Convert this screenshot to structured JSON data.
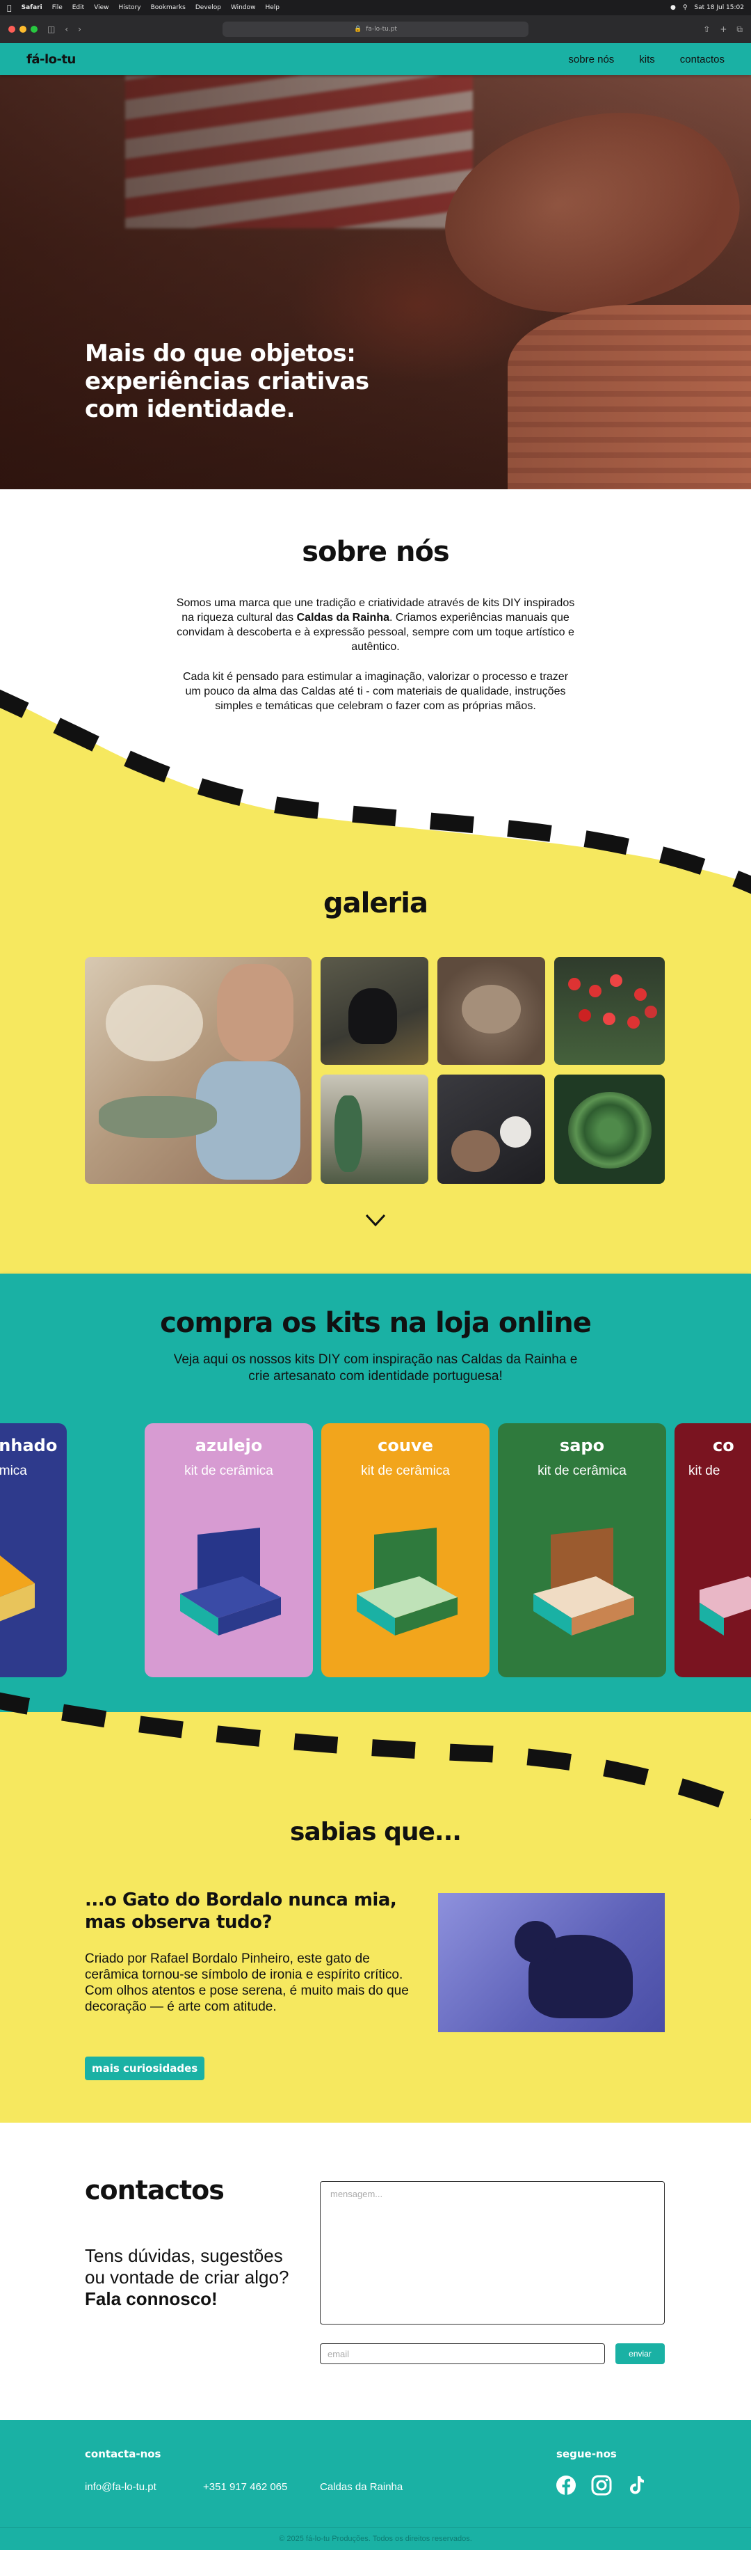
{
  "menubar": {
    "items": [
      "Safari",
      "File",
      "Edit",
      "View",
      "History",
      "Bookmarks",
      "Develop",
      "Window",
      "Help"
    ],
    "clock": "Sat 18 Jul 15:02"
  },
  "browser": {
    "url": "fa-lo-tu.pt"
  },
  "nav": {
    "logo": "fá-lo-tu",
    "links": [
      "sobre nós",
      "kits",
      "contactos"
    ]
  },
  "hero": {
    "headline": "Mais do que objetos: experiências criativas com identidade."
  },
  "sobre": {
    "title": "sobre nós",
    "p1_a": "Somos uma marca que une tradição e criatividade através de kits DIY inspirados na riqueza cultural das ",
    "p1_bold": "Caldas da Rainha",
    "p1_b": ". Criamos experiências manuais que convidam à descoberta e à expressão pessoal, sempre com um toque artístico e autêntico.",
    "p2": "Cada kit é pensado para estimular a imaginação, valorizar o processo e trazer um pouco da alma das Caldas até ti - com materiais de qualidade, instruções simples e temáticas que celebram o fazer com as próprias mãos."
  },
  "galeria": {
    "title": "galeria"
  },
  "shop": {
    "title": "compra os kits na loja online",
    "subtitle": "Veja aqui os nossos kits DIY com inspiração nas Caldas da Rainha e crie artesanato com identidade portuguesa!",
    "kits": [
      {
        "name": "gato assanhado",
        "sub": "kit de cerâmica",
        "color": "#2e3a8c"
      },
      {
        "name": "azulejo",
        "sub": "kit de cerâmica",
        "color": "#d79bd2"
      },
      {
        "name": "couve",
        "sub": "kit de cerâmica",
        "color": "#f2a51c"
      },
      {
        "name": "sapo",
        "sub": "kit de cerâmica",
        "color": "#2f7a3d"
      },
      {
        "name": "co",
        "sub": "kit de",
        "color": "#7a1420"
      }
    ]
  },
  "sabias": {
    "title": "sabias que...",
    "heading": "...o Gato do Bordalo nunca mia, mas observa tudo?",
    "text1": "Criado por Rafael Bordalo Pinheiro, este gato de cerâmica tornou-se símbolo de ironia e espírito crítico.",
    "text2": "Com olhos atentos e pose serena, é muito mais do que decoração — é arte com atitude.",
    "button": "mais curiosidades"
  },
  "contactos": {
    "title": "contactos",
    "question": "Tens dúvidas, sugestões ou vontade de criar algo?",
    "cta": "Fala connosco!",
    "message_placeholder": "mensagem...",
    "email_placeholder": "email",
    "send": "enviar"
  },
  "footer": {
    "contact_heading": "contacta-nos",
    "email": "info@fa-lo-tu.pt",
    "phone": "+351 917 462 065",
    "location": "Caldas da Rainha",
    "social_heading": "segue-nos",
    "copyright": "© 2025 fá-lo-tu Produções. Todos os direitos reservados."
  },
  "colors": {
    "teal": "#1ab1a4",
    "yellow": "#f6e85f",
    "black": "#111111"
  }
}
